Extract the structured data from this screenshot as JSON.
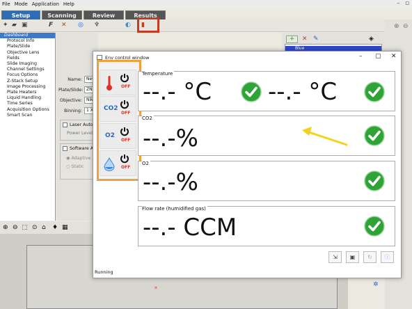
{
  "menu": [
    "File",
    "Mode",
    "Application",
    "Help"
  ],
  "tabs": [
    {
      "label": "Setup",
      "active": true
    },
    {
      "label": "Scanning",
      "active": false
    },
    {
      "label": "Review",
      "active": false
    },
    {
      "label": "Results",
      "active": false
    }
  ],
  "sidebar": {
    "items": [
      "Dashboard",
      "Protocol Info",
      "Plate/Slide",
      "Objective Lens",
      "Fields",
      "Slide Imaging",
      "Channel Settings",
      "Focus Options",
      "Z-Stack Setup",
      "Image Processing",
      "Plate Heaters",
      "Liquid Handling",
      "Time Series",
      "Acquisition Options",
      "Smart Scan"
    ]
  },
  "form": {
    "name_label": "Name:",
    "name_value": "New",
    "plate_label": "Plate/Slide:",
    "plate_value": "ZN",
    "objective_label": "Objective:",
    "objective_value": "Nik",
    "binning_label": "Binning:",
    "binning_value": "1 X",
    "laser_label": "Laser Auto",
    "power_label": "Power Level",
    "software_label": "Software Au",
    "adaptive_label": "Adaptive",
    "static_label": "Static"
  },
  "right_panel": {
    "item": "Blue"
  },
  "dialog": {
    "title": "Env control window",
    "status": "Running",
    "sensors": [
      {
        "icon": "thermometer-icon",
        "label": "",
        "state": "OFF"
      },
      {
        "icon": "co2-label",
        "label": "CO2",
        "state": "OFF"
      },
      {
        "icon": "o2-label",
        "label": "O2",
        "state": "OFF"
      },
      {
        "icon": "humidity-drop-icon",
        "label": "",
        "state": "OFF"
      }
    ],
    "sections": [
      {
        "label": "Temperature",
        "value1": "--.- °C",
        "value2": "--.- °C"
      },
      {
        "label": "CO2",
        "value1": "--.-%"
      },
      {
        "label": "O2",
        "value1": "--.-%"
      },
      {
        "label": "Flow rate (humidified gas)",
        "value1": "--.- CCM"
      }
    ]
  },
  "colors": {
    "accent": "#2d6db6",
    "highlight_orange": "#f0a23a",
    "highlight_red": "#c23b22",
    "check_green": "#2fa336",
    "arrow_yellow": "#f2d21b"
  }
}
